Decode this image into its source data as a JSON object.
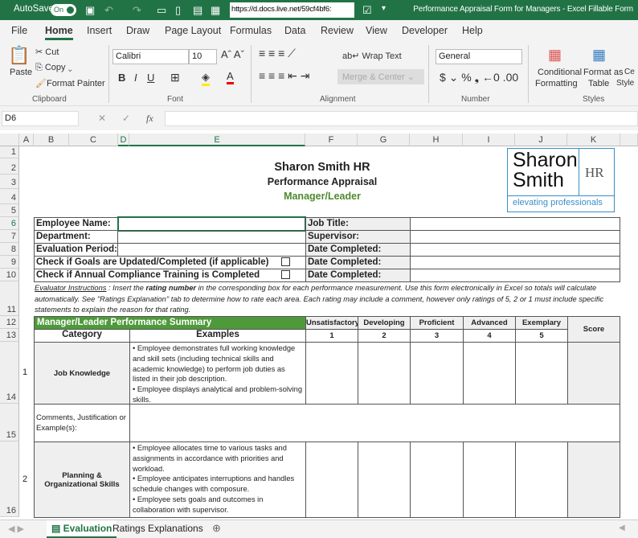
{
  "titlebar": {
    "autosave": "AutoSave",
    "toggle": "On",
    "url": "https://d.docs.live.net/59cf4bf6:",
    "title": "Performance Appraisal Form for Managers - Excel Fillable Form"
  },
  "tabs": [
    "File",
    "Home",
    "Insert",
    "Draw",
    "Page Layout",
    "Formulas",
    "Data",
    "Review",
    "View",
    "Developer",
    "Help"
  ],
  "ribbon": {
    "paste": "Paste",
    "cut": "Cut",
    "copy": "Copy",
    "format_painter": "Format Painter",
    "clipboard": "Clipboard",
    "font_name": "Calibri",
    "font_size": "10",
    "font": "Font",
    "wrap_text": "Wrap Text",
    "merge_center": "Merge & Center",
    "alignment": "Alignment",
    "number_format": "General",
    "number": "Number",
    "conditional": "Conditional",
    "formatting": "Formatting",
    "format_as": "Format as",
    "table": "Table",
    "cell": "Ce",
    "styles_lbl": "Style",
    "styles": "Styles"
  },
  "formula_bar": {
    "name_box": "D6",
    "fx": "fx",
    "value": ""
  },
  "columns": [
    "A",
    "B",
    "C",
    "D",
    "E",
    "F",
    "G",
    "H",
    "I",
    "J",
    "K"
  ],
  "rows": [
    "1",
    "2",
    "3",
    "4",
    "5",
    "6",
    "7",
    "8",
    "9",
    "10",
    "11",
    "12",
    "13",
    "14",
    "15",
    "16"
  ],
  "sheet": {
    "company": "Sharon Smith HR",
    "form_title": "Performance Appraisal",
    "subtitle": "Manager/Leader",
    "logo": {
      "line1": "Sharon",
      "line2": "Smith",
      "hr": "HR",
      "tagline": "elevating professionals"
    },
    "employee_name": "Employee Name:",
    "department": "Department:",
    "evaluation_period": "Evaluation Period:",
    "goals_check": "Check if Goals are Updated/Completed (if applicable)",
    "compliance_check": "Check if Annual Compliance Training is Completed",
    "job_title": "Job Title:",
    "supervisor": "Supervisor:",
    "date_completed": "Date Completed:",
    "instructions_label": "Evaluator Instructions",
    "instructions_pre": " : Insert the ",
    "instructions_bold": "rating number",
    "instructions_post": " in the corresponding box for each performance measurement. Use this form electronically in Excel so totals will calculate automatically. See \"Ratings Explanation\" tab to determine how to rate each area. Each rating may include a comment, however only ratings of 5, 2 or 1 must include specific statements to explain the reason for that rating.",
    "summary_title": "Manager/Leader Performance Summary",
    "category": "Category",
    "examples": "Examples",
    "score": "Score",
    "ratings": [
      {
        "label": "Unsatisfactory",
        "num": "1"
      },
      {
        "label": "Developing",
        "num": "2"
      },
      {
        "label": "Proficient",
        "num": "3"
      },
      {
        "label": "Advanced",
        "num": "4"
      },
      {
        "label": "Exemplary",
        "num": "5"
      }
    ],
    "items": [
      {
        "n": "1",
        "category": "Job Knowledge",
        "examples": "• Employee demonstrates full working knowledge and skill sets (including technical skills and academic knowledge) to perform job duties as listed in their job description.\n• Employee displays analytical and problem-solving skills."
      },
      {
        "n": "2",
        "category": "Planning & Organizational Skills",
        "examples": "•  Employee allocates time to various tasks and assignments in accordance with priorities and workload.\n•  Employee anticipates interruptions and handles schedule changes with composure.\n•  Employee sets goals and outcomes in collaboration with supervisor."
      }
    ],
    "comments": "Comments, Justification or Example(s):"
  },
  "sheet_tabs": [
    "Evaluation",
    "Ratings Explanations"
  ],
  "colors": {
    "green": "#217346",
    "section": "#4e9a3a",
    "subtitle": "#4e8a2e"
  }
}
